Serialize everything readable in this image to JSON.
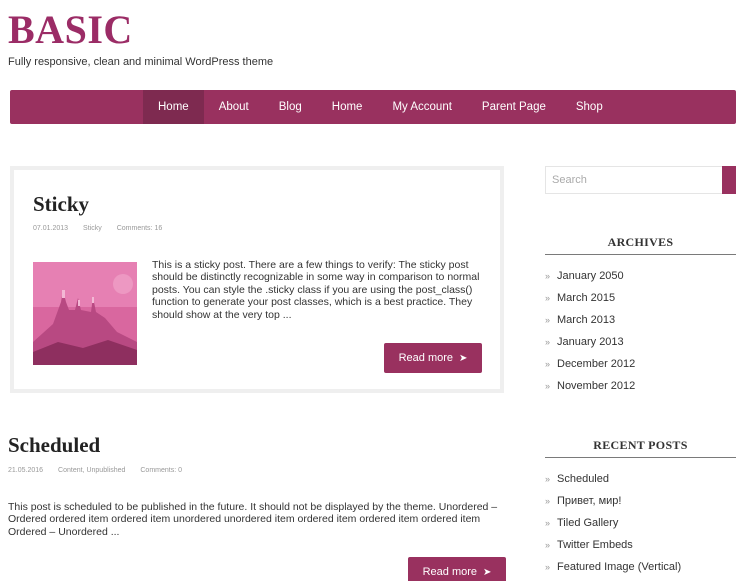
{
  "site": {
    "title": "BASIC",
    "tagline": "Fully responsive, clean and minimal WordPress theme"
  },
  "nav": {
    "items": [
      "Home",
      "About",
      "Blog",
      "Home",
      "My Account",
      "Parent Page",
      "Shop"
    ],
    "active_index": 0
  },
  "posts": [
    {
      "title": "Sticky",
      "date": "07.01.2013",
      "category": "Sticky",
      "comments": "Comments: 16",
      "excerpt": "This is a sticky post. There are a few things to verify: The sticky post should be distinctly recognizable in some way in comparison to normal posts. You can style the .sticky class if you are using the post_class() function to generate your post classes, which is a best practice. They should show at the very top ...",
      "read_more": "Read more"
    },
    {
      "title": "Scheduled",
      "date": "21.05.2016",
      "category": "Content, Unpublished",
      "comments": "Comments: 0",
      "excerpt": "This post is scheduled to be published in the future. It should not be displayed by the theme. Unordered – Ordered ordered item ordered item unordered unordered item ordered item ordered item ordered item Ordered – Unordered ...",
      "read_more": "Read more"
    }
  ],
  "sidebar": {
    "search_placeholder": "Search",
    "archives": {
      "title": "ARCHIVES",
      "items": [
        "January 2050",
        "March 2015",
        "March 2013",
        "January 2013",
        "December 2012",
        "November 2012"
      ]
    },
    "recent_posts": {
      "title": "RECENT POSTS",
      "items": [
        "Scheduled",
        "Привет, мир!",
        "Tiled Gallery",
        "Twitter Embeds",
        "Featured Image (Vertical)"
      ]
    }
  },
  "colors": {
    "accent": "#99315f",
    "accent_dark": "#7e2a50",
    "title": "#9b2c66"
  }
}
